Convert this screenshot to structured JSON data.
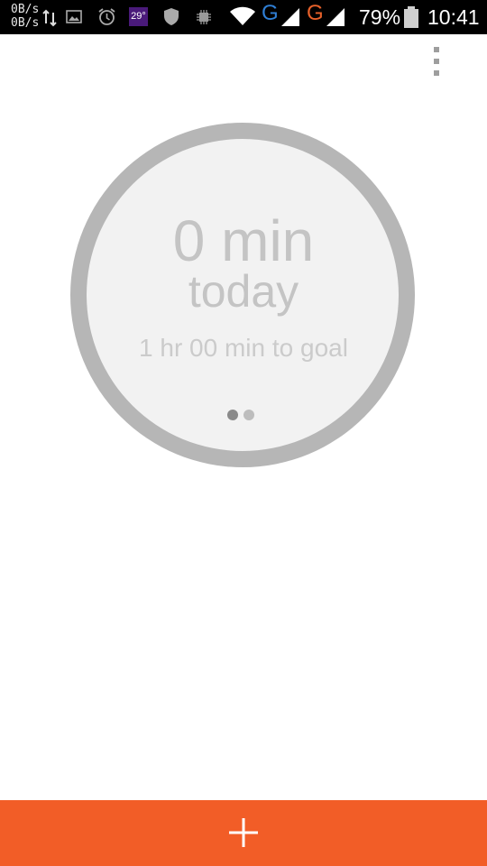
{
  "status_bar": {
    "net_up": "0B/s",
    "net_down": "0B/s",
    "temperature": "29°",
    "g1": "G",
    "g2": "G",
    "battery": "79%",
    "time": "10:41",
    "icons": [
      "data-transfer-icon",
      "image-icon",
      "alarm-icon",
      "temperature-badge",
      "shield-icon",
      "chip-icon",
      "wifi-icon",
      "signal-icon",
      "battery-icon"
    ],
    "colors": {
      "g1": "#2f7fd6",
      "g2": "#e8612a"
    }
  },
  "toolbar": {
    "menu_icon": "overflow-menu-icon"
  },
  "progress": {
    "value": "0 min",
    "period": "today",
    "goal_text": "1 hr 00 min to goal",
    "fraction": 0,
    "pages": 2,
    "current_page": 1
  },
  "action": {
    "add_icon": "plus-icon",
    "color": "#f25d27"
  }
}
